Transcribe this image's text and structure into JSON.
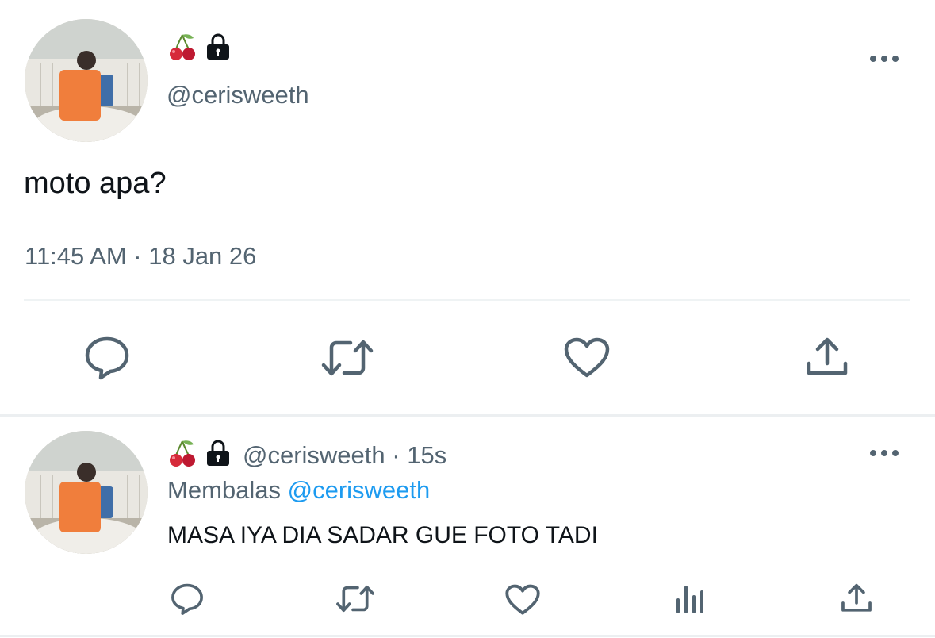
{
  "colors": {
    "muted": "#536471",
    "link": "#1d9bf0",
    "text": "#0f1419",
    "divider": "#eff3f4"
  },
  "main_tweet": {
    "display_name_icons": [
      "cherry-icon",
      "lock-icon"
    ],
    "handle": "@cerisweeth",
    "text": "moto apa?",
    "timestamp": "11:45 AM · 18 Jan 26",
    "actions": [
      "reply-icon",
      "retweet-icon",
      "like-icon",
      "share-icon"
    ]
  },
  "reply_tweet": {
    "display_name_icons": [
      "cherry-icon",
      "lock-icon"
    ],
    "handle": "@cerisweeth",
    "time_ago": "· 15s",
    "replying_prefix": "Membalas",
    "replying_to": "@cerisweeth",
    "text": "MASA IYA DIA SADAR GUE FOTO TADI",
    "actions": [
      "reply-icon",
      "retweet-icon",
      "like-icon",
      "analytics-icon",
      "share-icon"
    ]
  }
}
